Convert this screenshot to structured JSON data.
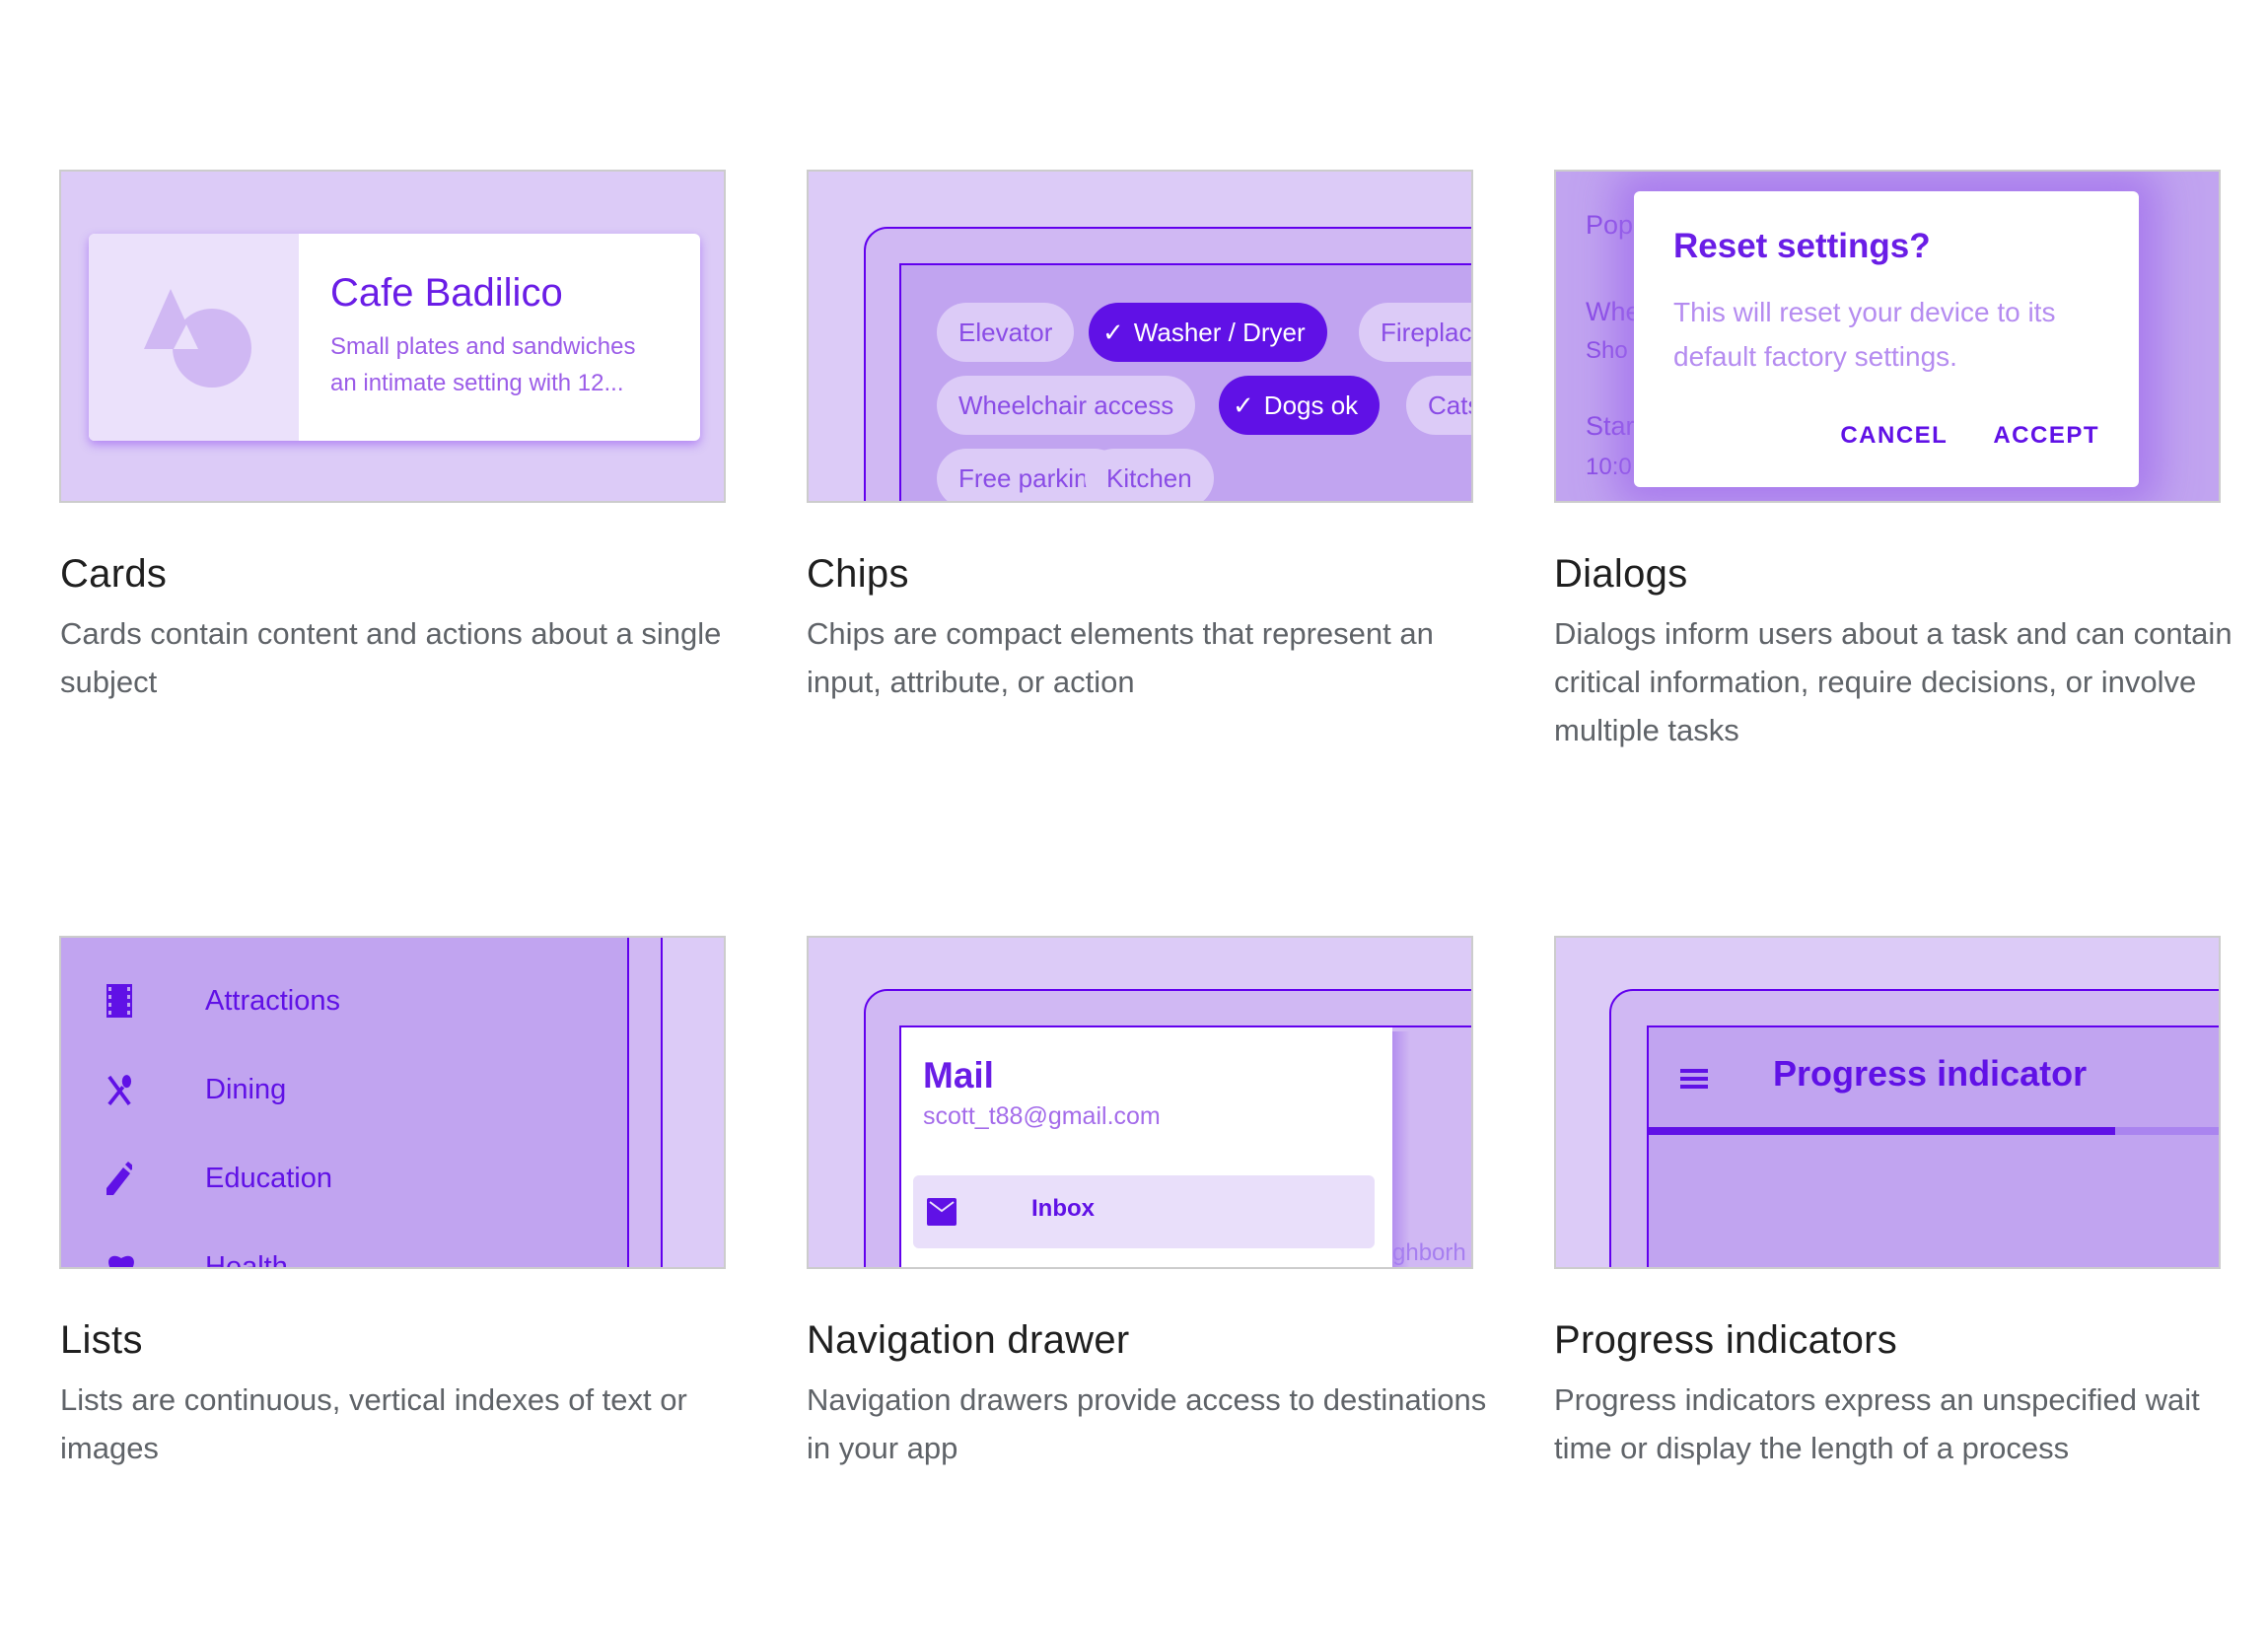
{
  "components": [
    {
      "title": "Cards",
      "description": "Cards contain content and actions about a single subject",
      "preview": {
        "card_title": "Cafe Badilico",
        "card_description_line1": "Small plates and sandwiches",
        "card_description_line2": "an intimate setting with 12..."
      }
    },
    {
      "title": "Chips",
      "description": "Chips are compact elements that represent an input, attribute, or action",
      "preview": {
        "chips": [
          {
            "label": "Elevator",
            "selected": false
          },
          {
            "label": "Washer / Dryer",
            "selected": true
          },
          {
            "label": "Fireplace",
            "selected": false
          },
          {
            "label": "Wheelchair access",
            "selected": false
          },
          {
            "label": "Dogs ok",
            "selected": true
          },
          {
            "label": "Cats",
            "selected": false
          },
          {
            "label": "Free parking",
            "selected": false
          },
          {
            "label": "Kitchen",
            "selected": false
          }
        ],
        "check_glyph": "✓"
      }
    },
    {
      "title": "Dialogs",
      "description": "Dialogs inform users about a task and can contain critical information, require decisions, or involve multiple tasks",
      "preview": {
        "background_lines": [
          "Pop",
          "Whe",
          "Sho",
          "Star",
          "10:0"
        ],
        "dialog_title": "Reset settings?",
        "dialog_body": "This will reset your device to its default factory settings.",
        "cancel_label": "CANCEL",
        "accept_label": "ACCEPT"
      }
    },
    {
      "title": "Lists",
      "description": "Lists are continuous, vertical indexes of text or images",
      "preview": {
        "items": [
          {
            "label": "Attractions",
            "icon": "film-icon"
          },
          {
            "label": "Dining",
            "icon": "restaurant-icon"
          },
          {
            "label": "Education",
            "icon": "pencil-icon"
          },
          {
            "label": "Health",
            "icon": "heart-icon"
          }
        ]
      }
    },
    {
      "title": "Navigation drawer",
      "description": "Navigation drawers provide access to destinations in your app",
      "preview": {
        "drawer_title": "Mail",
        "drawer_subtitle": "scott_t88@gmail.com",
        "active_item": "Inbox",
        "peek_text": "ghborh"
      }
    },
    {
      "title": "Progress indicators",
      "description": "Progress indicators express an unspecified wait time or display the length of a process",
      "preview": {
        "appbar_title": "Progress indicator",
        "progress_fraction": 0.68
      }
    }
  ],
  "colors": {
    "primary": "#6200ee",
    "tile_bg": "#dccbf7",
    "tile_mid": "#c1a4f0",
    "heading_text": "#1f1f1f",
    "body_text": "#5f6368"
  }
}
